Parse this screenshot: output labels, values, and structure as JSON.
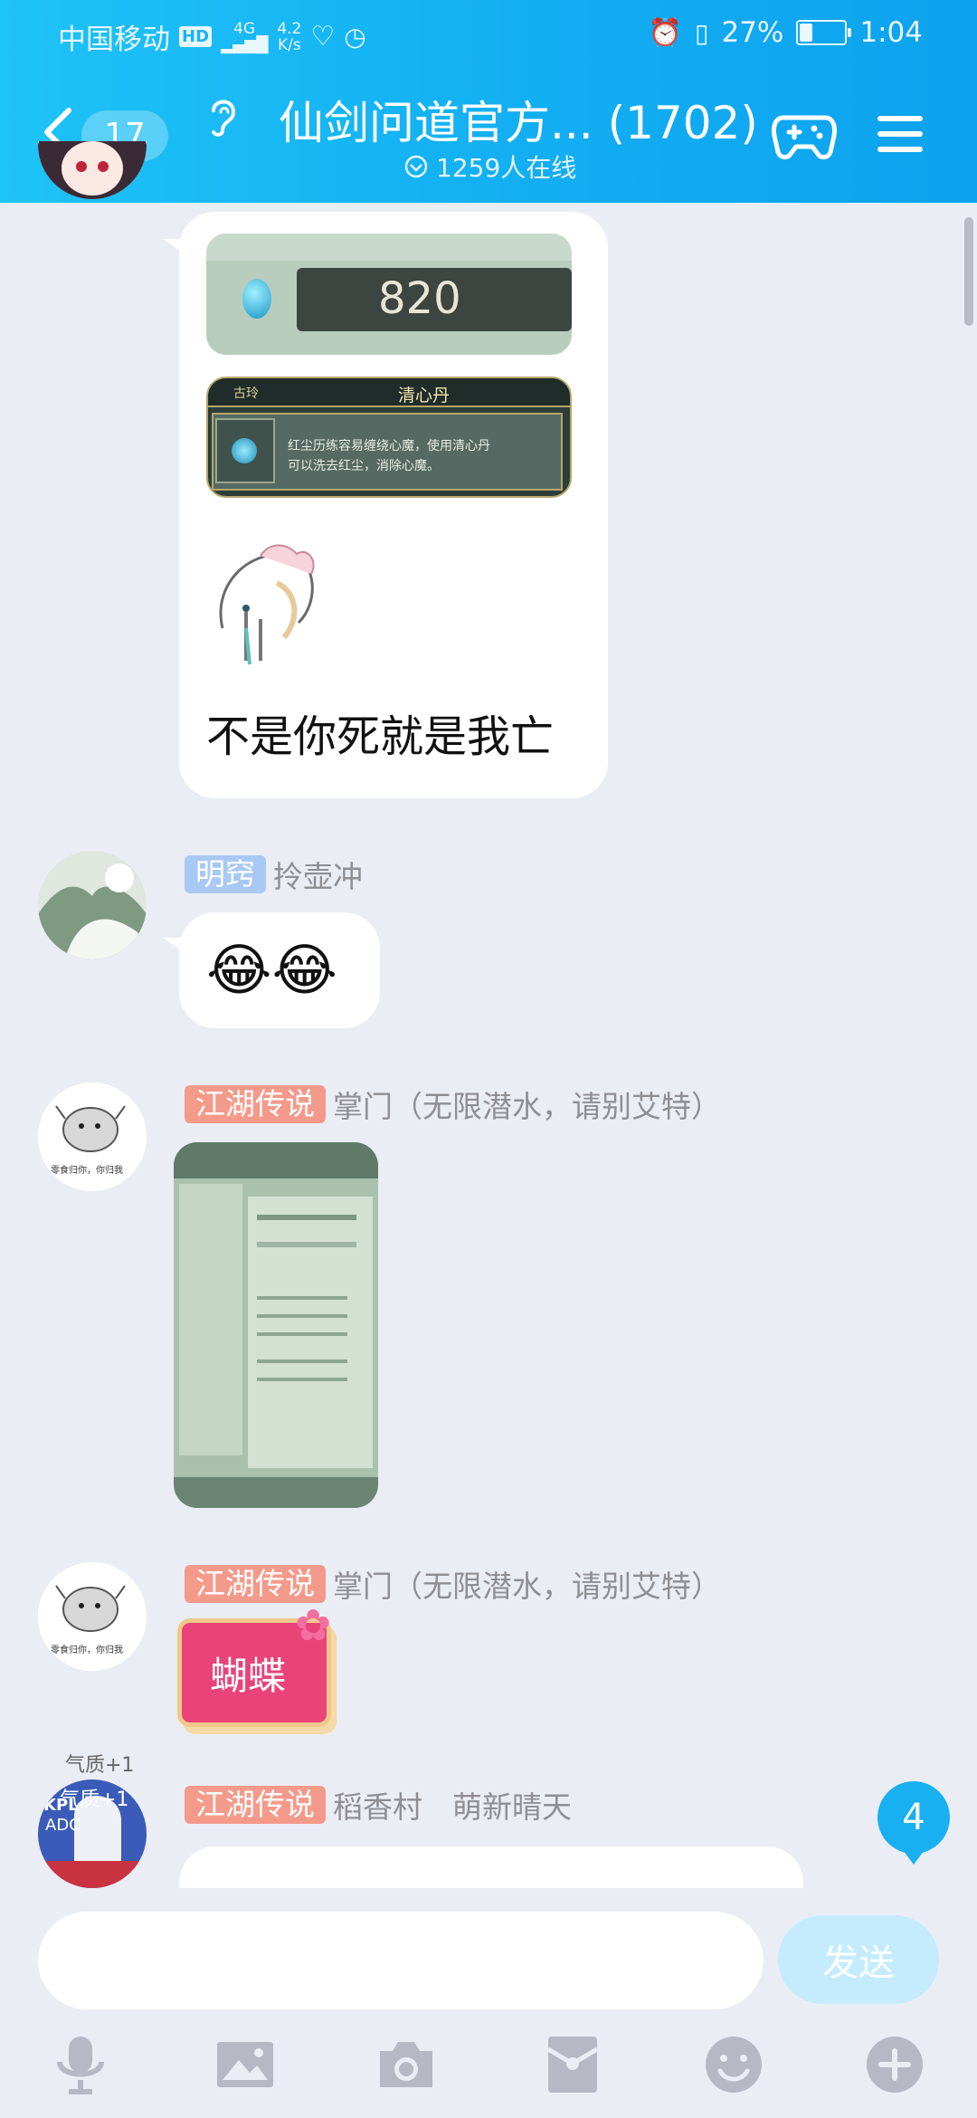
{
  "status_bar": {
    "carrier": "中国移动",
    "hd": "HD",
    "signal": "4G",
    "net_speed_value": "4.2",
    "net_speed_unit": "K/s",
    "battery": "27%",
    "time": "1:04"
  },
  "header": {
    "unread_count": "17",
    "title": "仙剑问道官方... (1702)",
    "online": "1259人在线"
  },
  "messages": [
    {
      "screenshot_value": "820",
      "item_tier": "古玲",
      "item_name": "清心丹",
      "item_desc_line1": "红尘历练容易缠绕心魔，使用清心丹",
      "item_desc_line2": "可以洗去红尘，消除心魔。",
      "text": "不是你死就是我亡"
    },
    {
      "tag": "明窍",
      "sender": "拎壶冲",
      "text": "😂😂"
    },
    {
      "tag": "江湖传说",
      "sender": "掌门（无限潜水，请别艾特）"
    },
    {
      "tag": "江湖传说",
      "sender": "掌门（无限潜水，请别艾特）",
      "sticker_text": "蝴蝶"
    },
    {
      "tag": "江湖传说",
      "sender": "稻香村　萌新晴天",
      "avatar_overlay_1": "气质+1",
      "avatar_overlay_2": "气质+1",
      "avatar_badge": "KPL",
      "avatar_badge_2": "ADC"
    }
  ],
  "avatar_caption": "零食归你，你归我",
  "new_messages_count": "4",
  "composer": {
    "placeholder": "",
    "send_label": "发送"
  },
  "toolbar_icons": [
    "microphone-icon",
    "image-icon",
    "camera-icon",
    "red-packet-icon",
    "emoji-icon",
    "plus-icon"
  ],
  "colors": {
    "header": "#12aef2",
    "background": "#ebedf5",
    "send_button_disabled": "#c4ecfc",
    "tag_blue": "#a9c9f5",
    "tag_red": "#f49a8a"
  }
}
